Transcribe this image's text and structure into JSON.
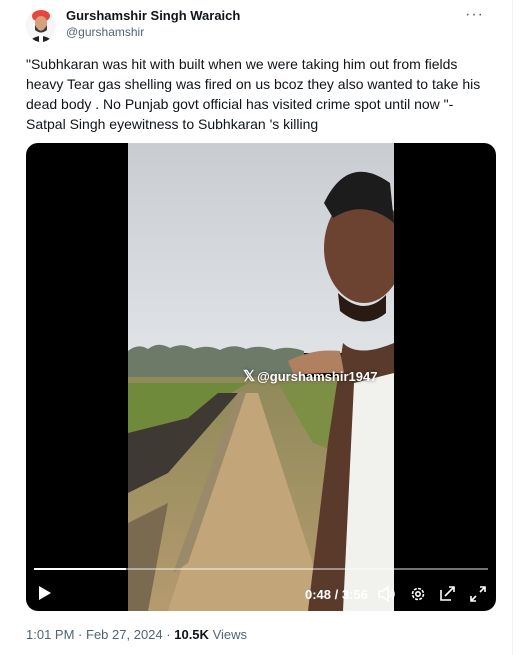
{
  "author": {
    "name": "Gurshamshir Singh Waraich",
    "handle": "@gurshamshir"
  },
  "tweet": {
    "lines": [
      "\"Subhkaran was hit with built when we were taking him out from fields",
      "heavy Tear gas shelling was fired on us bcoz they also wanted to take his",
      "dead body  .  No Punjab govt official has visited crime spot  until now \"-",
      "Satpal Singh eyewitness to Subhkaran 's killing"
    ]
  },
  "video": {
    "watermark": "@gurshamshir1947",
    "current_time": "0:48",
    "separator": "/",
    "duration": "3:56",
    "progress": 0.203,
    "icons": [
      "play-icon",
      "volume-icon",
      "settings-icon",
      "pip-icon",
      "fullscreen-icon"
    ]
  },
  "meta": {
    "time": "1:01 PM",
    "dot": "·",
    "date": "Feb 27, 2024",
    "views_count": "10.5K",
    "views_label": "Views"
  },
  "colors": {
    "secondary_text": "#536471",
    "primary_text": "#0f1419",
    "turban": "#e3473e"
  }
}
